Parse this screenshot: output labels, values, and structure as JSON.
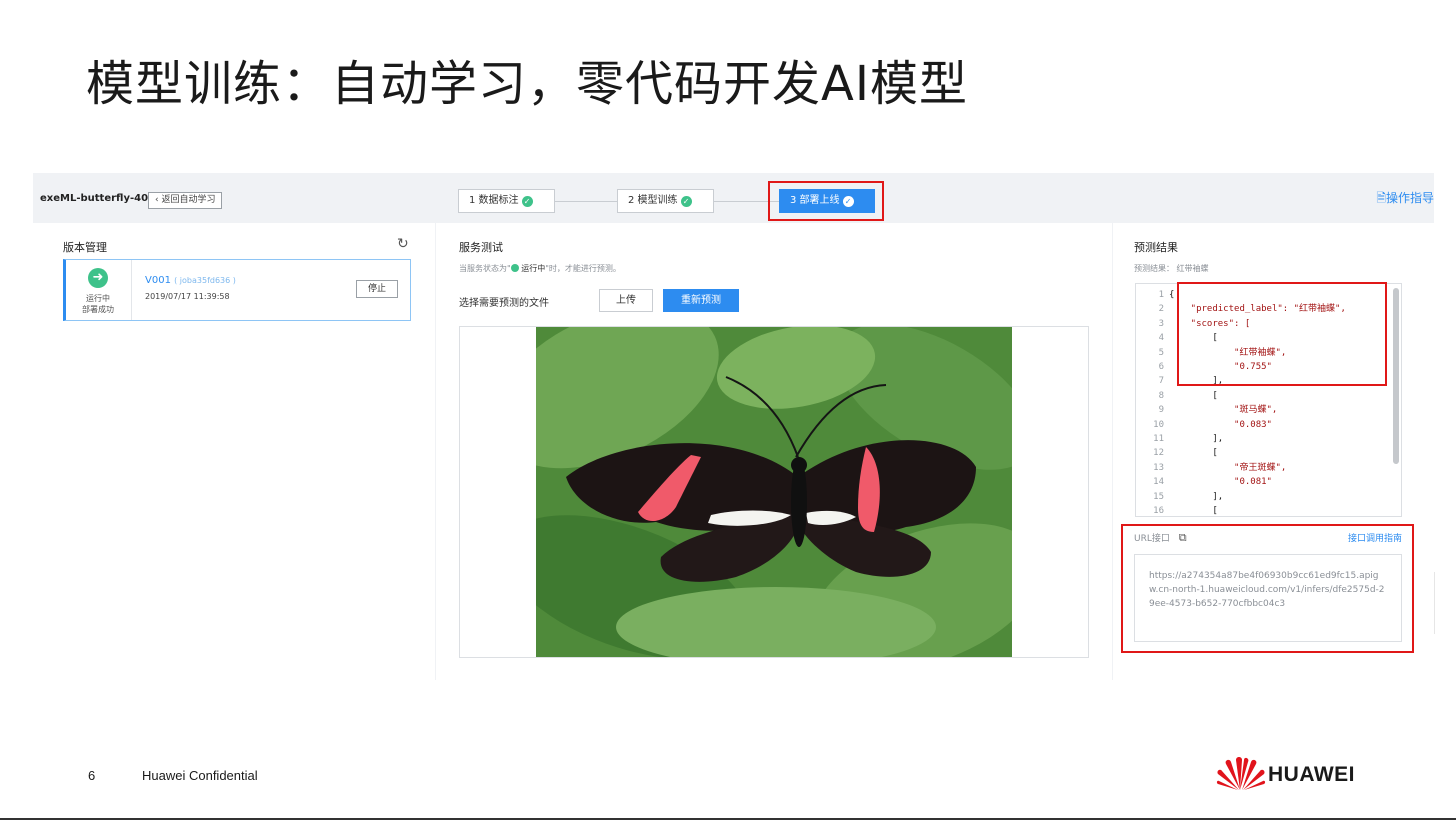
{
  "slide": {
    "title": "模型训练：自动学习，零代码开发AI模型",
    "page_number": "6",
    "confidential": "Huawei Confidential",
    "logo_text": "HUAWEI"
  },
  "header": {
    "project_name": "exeML-butterfly-40",
    "back_label": "返回自动学习",
    "steps": [
      {
        "label": "1 数据标注",
        "done": true
      },
      {
        "label": "2 模型训练",
        "done": true
      },
      {
        "label": "3 部署上线",
        "done": true,
        "active": true
      }
    ],
    "guide_label": "操作指导"
  },
  "versions": {
    "title": "版本管理",
    "card": {
      "status_line1": "运行中",
      "status_line2": "部署成功",
      "version": "V001",
      "job": "( joba35fd636 )",
      "time": "2019/07/17 11:39:58",
      "stop_label": "停止"
    }
  },
  "service_test": {
    "title": "服务测试",
    "hint_prefix": "当服务状态为\"",
    "hint_status": "运行中",
    "hint_suffix": "\"时，才能进行预测。",
    "select_label": "选择需要预测的文件",
    "upload_label": "上传",
    "repredict_label": "重新预测"
  },
  "prediction": {
    "title": "预测结果",
    "summary_label": "预测结果：",
    "summary_value": "红带袖蝶",
    "lines": [
      {
        "n": "1",
        "text": "{"
      },
      {
        "n": "2",
        "text": "    \"predicted_label\": \"红带袖蝶\","
      },
      {
        "n": "3",
        "text": "    \"scores\": ["
      },
      {
        "n": "4",
        "text": "        ["
      },
      {
        "n": "5",
        "text": "            \"红带袖蝶\","
      },
      {
        "n": "6",
        "text": "            \"0.755\""
      },
      {
        "n": "7",
        "text": "        ],"
      },
      {
        "n": "8",
        "text": "        ["
      },
      {
        "n": "9",
        "text": "            \"斑马蝶\","
      },
      {
        "n": "10",
        "text": "            \"0.083\""
      },
      {
        "n": "11",
        "text": "        ],"
      },
      {
        "n": "12",
        "text": "        ["
      },
      {
        "n": "13",
        "text": "            \"帝王斑蝶\","
      },
      {
        "n": "14",
        "text": "            \"0.081\""
      },
      {
        "n": "15",
        "text": "        ],"
      },
      {
        "n": "16",
        "text": "        ["
      }
    ],
    "url_label": "URL接口",
    "url_guide": "接口调用指南",
    "url_value": "https://a274354a87be4f06930b9cc61ed9fc15.apigw.cn-north-1.huaweicloud.com/v1/infers/dfe2575d-29ee-4573-b652-770cfbbc04c3"
  },
  "colors": {
    "accent": "#2d8cf0",
    "success": "#3ec28a",
    "highlight_red": "#e01818",
    "huawei_red": "#e1141c"
  }
}
